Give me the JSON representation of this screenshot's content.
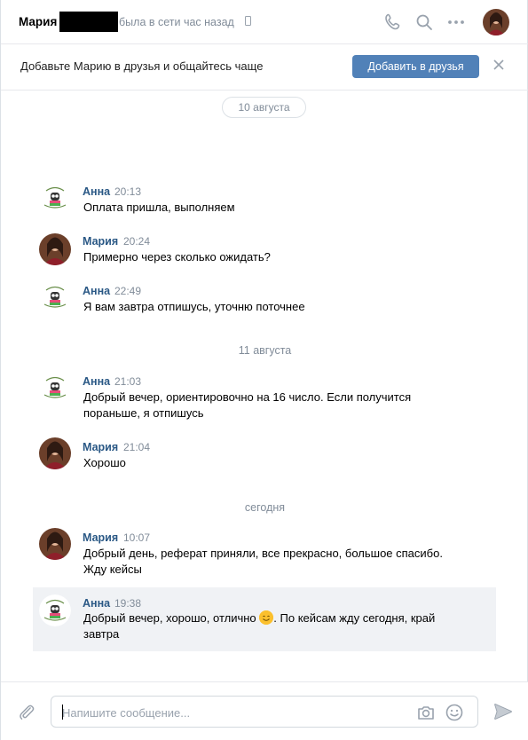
{
  "header": {
    "name": "Мария",
    "status": "была в сети час назад",
    "icons": [
      "phone-icon",
      "search-icon",
      "more-icon"
    ]
  },
  "add_friend": {
    "text": "Добавьте Марию в друзья и общайтесь чаще",
    "button_label": "Добавить в друзья"
  },
  "dates": {
    "first": "10 августа",
    "second": "11 августа",
    "third": "сегодня"
  },
  "messages": [
    {
      "author": "Анна",
      "time": "20:13",
      "text": "Оплата пришла, выполняем"
    },
    {
      "author": "Мария",
      "time": "20:24",
      "text": "Примерно через сколько ожидать?"
    },
    {
      "author": "Анна",
      "time": "22:49",
      "text": "Я вам завтра отпишусь, уточню поточнее"
    },
    {
      "author": "Анна",
      "time": "21:03",
      "text1": "Добрый вечер, ориентировочно на 16 число. Если получится",
      "text2": "пораньше, я отпишусь"
    },
    {
      "author": "Мария",
      "time": "21:04",
      "text": "Хорошо"
    },
    {
      "author": "Мария",
      "time": "10:07",
      "text1": "Добрый день, реферат приняли, все прекрасно, большое спасибо.",
      "text2": "Жду кейсы"
    },
    {
      "author": "Анна",
      "time": "19:38",
      "text1a": "Добрый вечер, хорошо, отлично ",
      "text1b": ". По кейсам жду сегодня, край",
      "text2": "завтра"
    }
  ],
  "composer": {
    "placeholder": "Напишите сообщение..."
  },
  "colors": {
    "accent": "#5181b8",
    "author": "#2a5885",
    "muted": "#818c99",
    "highlight": "#f0f2f5"
  }
}
